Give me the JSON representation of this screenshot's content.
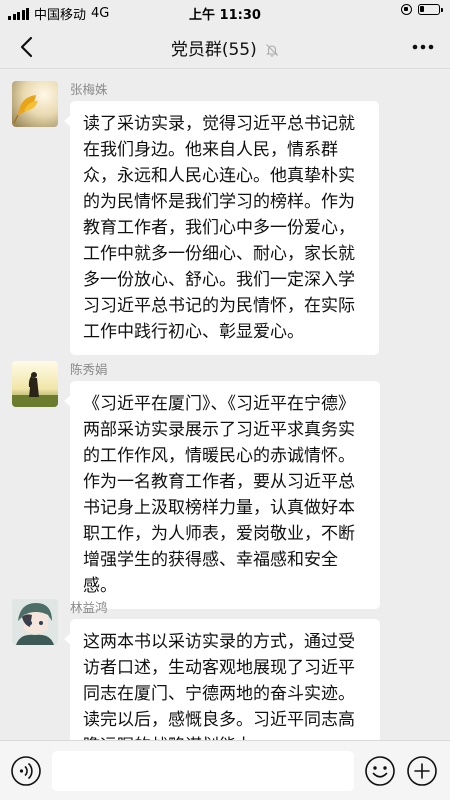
{
  "status_bar": {
    "carrier": "中国移动",
    "network": "4G",
    "time": "上午 11:30"
  },
  "nav": {
    "title": "党员群(55)",
    "muted": true,
    "icons": [
      "chevron-left-icon",
      "mute-bell-icon",
      "more-dots-icon"
    ]
  },
  "messages": [
    {
      "sender": "张梅姝",
      "avatar": "ginkgo-leaf-photo",
      "text": "读了采访实录，觉得习近平总书记就在我们身边。他来自人民，情系群众，永远和人民心连心。他真挚朴实的为民情怀是我们学习的榜样。作为教育工作者，我们心中多一份爱心，工作中就多一份细心、耐心，家长就多一份放心、舒心。我们一定深入学习习近平总书记的为民情怀，在实际工作中践行初心、彰显爱心。"
    },
    {
      "sender": "陈秀娟",
      "avatar": "sunset-silhouette-photo",
      "text": "《习近平在厦门》、《习近平在宁德》两部采访实录展示了习近平求真务实的工作作风，情暖民心的赤诚情怀。作为一名教育工作者，要从习近平总书记身上汲取榜样力量，认真做好本职工作，为人师表，爱岗敬业，不断增强学生的获得感、幸福感和安全感。"
    },
    {
      "sender": "林益鸿",
      "avatar": "anime-character-avatar",
      "text": "这两本书以采访实录的方式，通过受访者口述，生动客观地展现了习近平同志在厦门、宁德两地的奋斗实迹。读完以后，感慨良多。习近平同志高瞻远瞩的战略谋划能力、"
    }
  ],
  "input_bar": {
    "value": "",
    "icons": [
      "voice-icon",
      "emoji-icon",
      "plus-icon"
    ]
  },
  "colors": {
    "background": "#ededed",
    "bubble": "#ffffff",
    "sender_name": "#8a8a8a"
  }
}
